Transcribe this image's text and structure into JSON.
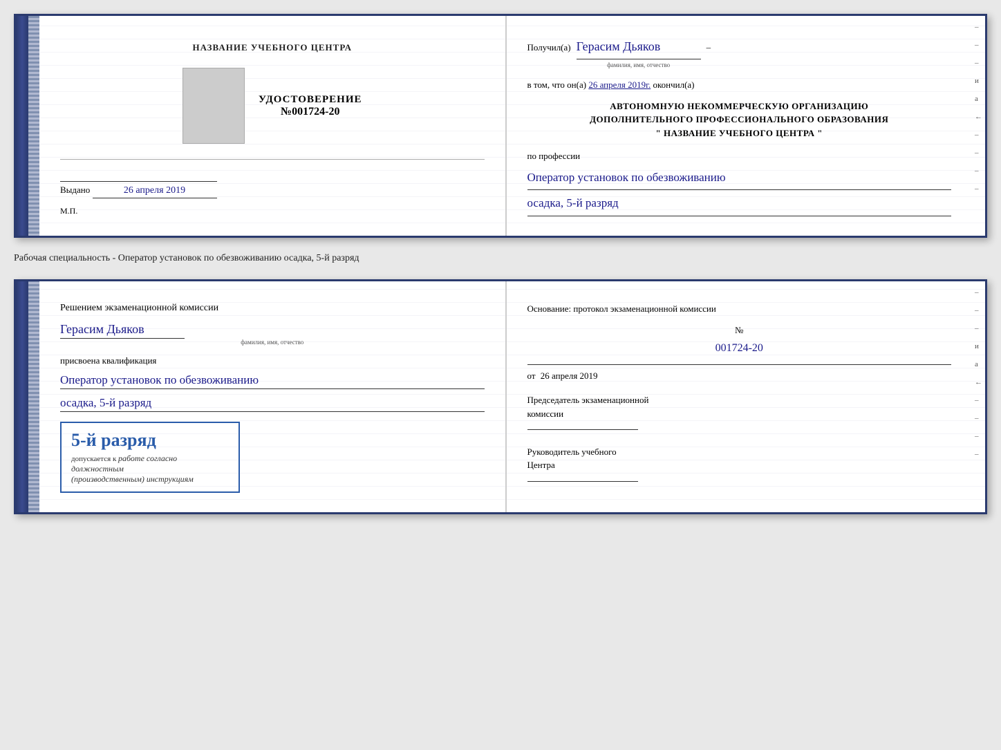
{
  "doc1": {
    "left": {
      "school_name": "НАЗВАНИЕ УЧЕБНОГО ЦЕНТРА",
      "cert_title": "УДОСТОВЕРЕНИЕ",
      "cert_number_prefix": "№",
      "cert_number": "001724-20",
      "issued_label": "Выдано",
      "issued_date": "26 апреля 2019",
      "mp_label": "М.П."
    },
    "right": {
      "received_label": "Получил(а)",
      "recipient_name": "Герасим Дьяков",
      "recipient_sublabel": "фамилия, имя, отчество",
      "dash": "–",
      "in_that_label": "в том, что он(а)",
      "completion_date": "26 апреля 2019г.",
      "completed_label": "окончил(а)",
      "org_line1": "АВТОНОМНУЮ НЕКОММЕРЧЕСКУЮ ОРГАНИЗАЦИЮ",
      "org_line2": "ДОПОЛНИТЕЛЬНОГО ПРОФЕССИОНАЛЬНОГО ОБРАЗОВАНИЯ",
      "org_quote_open": "\"",
      "org_name": "НАЗВАНИЕ УЧЕБНОГО ЦЕНТРА",
      "org_quote_close": "\"",
      "profession_label": "по профессии",
      "profession_name": "Оператор установок по обезвоживанию",
      "rank_text": "осадка, 5-й разряд"
    }
  },
  "caption": "Рабочая специальность - Оператор установок по обезвоживанию осадка, 5-й разряд",
  "doc2": {
    "left": {
      "decision_title": "Решением экзаменационной комиссии",
      "person_name": "Герасим Дьяков",
      "person_sublabel": "фамилия, имя, отчество",
      "assigned_label": "присвоена квалификация",
      "qualification_line1": "Оператор установок по обезвоживанию",
      "qualification_line2": "осадка, 5-й разряд",
      "stamp_rank": "5-й разряд",
      "stamp_allowed": "допускается к",
      "stamp_work": "работе согласно должностным",
      "stamp_instructions": "(производственным) инструкциям"
    },
    "right": {
      "basis_title": "Основание: протокол экзаменационной комиссии",
      "protocol_prefix": "№",
      "protocol_number": "001724-20",
      "date_from_label": "от",
      "date_from_value": "26 апреля 2019",
      "chairman_label": "Председатель экзаменационной",
      "chairman_label2": "комиссии",
      "leader_label": "Руководитель учебного",
      "leader_label2": "Центра"
    }
  },
  "dash_marks": [
    "–",
    "–",
    "–",
    "и",
    "а",
    "←",
    "–",
    "–",
    "–",
    "–"
  ]
}
